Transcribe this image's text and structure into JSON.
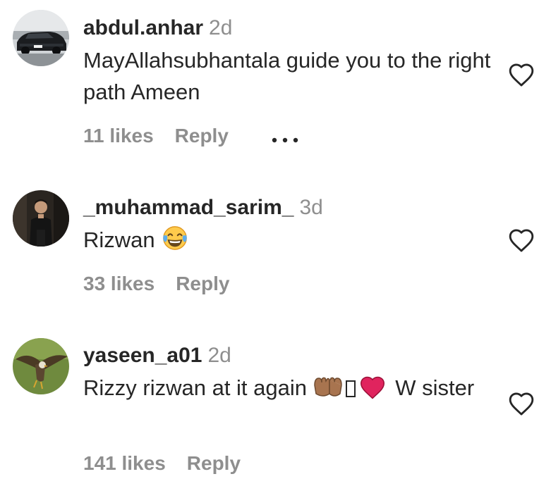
{
  "comments": [
    {
      "username": "abdul.anhar",
      "time": "2d",
      "text": "MayAllahsubhantala guide you to the right path Ameen",
      "likes": "11 likes",
      "reply": "Reply",
      "avatar_icon": "car-avatar"
    },
    {
      "username": "_muhammad_sarim_",
      "time": "3d",
      "text": "Rizwan",
      "text_emoji": "face-with-tears-of-joy",
      "likes": "33 likes",
      "reply": "Reply",
      "avatar_icon": "person-avatar"
    },
    {
      "username": "yaseen_a01",
      "time": "2d",
      "text_before_emoji": "Rizzy rizwan at it again",
      "text_emojis": [
        "palms-up-together",
        "missing-glyph",
        "red-heart"
      ],
      "text_after_emoji": "W sister",
      "likes": "141 likes",
      "reply": "Reply",
      "avatar_icon": "eagle-avatar"
    }
  ],
  "colors": {
    "primary_text": "#262626",
    "secondary_text": "#8e8e8e",
    "heart_outline": "#262626",
    "heart_emoji": "#e0245e"
  }
}
